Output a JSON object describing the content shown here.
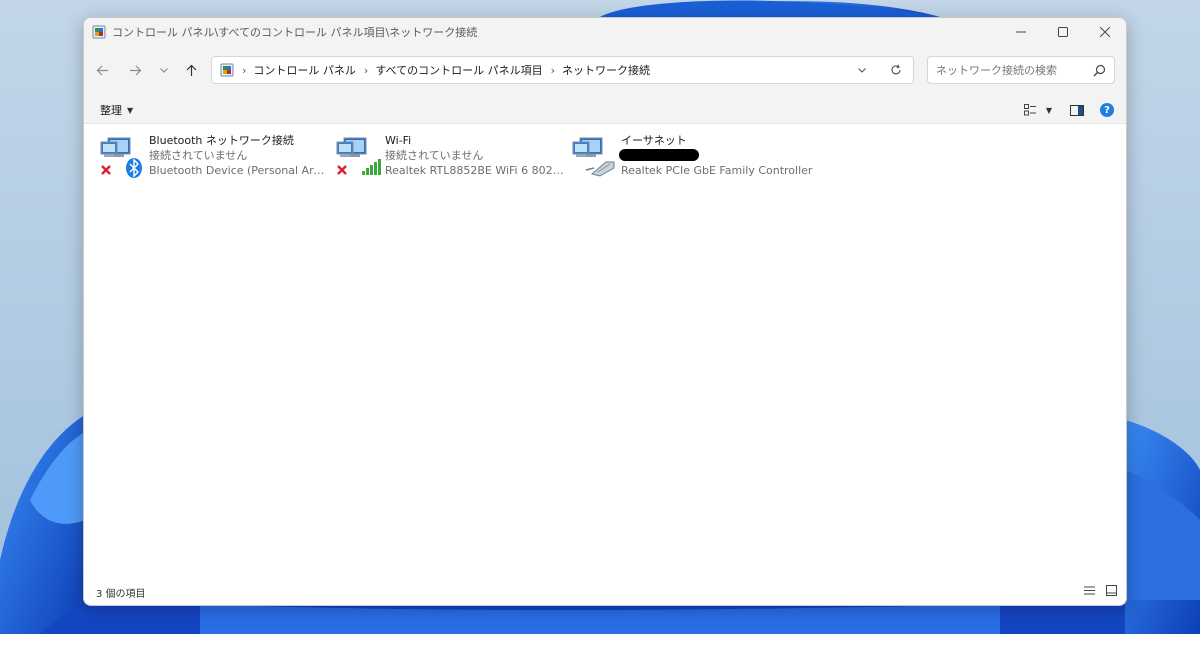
{
  "window": {
    "title": "コントロール パネル\\すべてのコントロール パネル項目\\ネットワーク接続"
  },
  "navigation": {
    "breadcrumbs": [
      "コントロール パネル",
      "すべてのコントロール パネル項目",
      "ネットワーク接続"
    ],
    "search_placeholder": "ネットワーク接続の検索"
  },
  "command_bar": {
    "organize_label": "整理",
    "help_label": "?"
  },
  "connections": [
    {
      "name": "Bluetooth ネットワーク接続",
      "status": "接続されていません",
      "device": "Bluetooth Device (Personal Area ...",
      "badge_icon": "bluetooth-icon",
      "disconnected": true
    },
    {
      "name": "Wi-Fi",
      "status": "接続されていません",
      "device": "Realtek RTL8852BE WiFi 6 802.11a...",
      "badge_icon": "wifi-signal-icon",
      "disconnected": true
    },
    {
      "name": "イーサネット",
      "status": "",
      "device": "Realtek PCIe GbE Family Controller",
      "badge_icon": "ethernet-cable-icon",
      "disconnected": false,
      "status_redacted": true
    }
  ],
  "status_bar": {
    "item_count": "3 個の項目"
  },
  "colors": {
    "accent": "#1f7ee2",
    "wallpaper_blue": "#1a5fd6",
    "error_red": "#d7262e",
    "signal_green": "#3aa83a"
  }
}
